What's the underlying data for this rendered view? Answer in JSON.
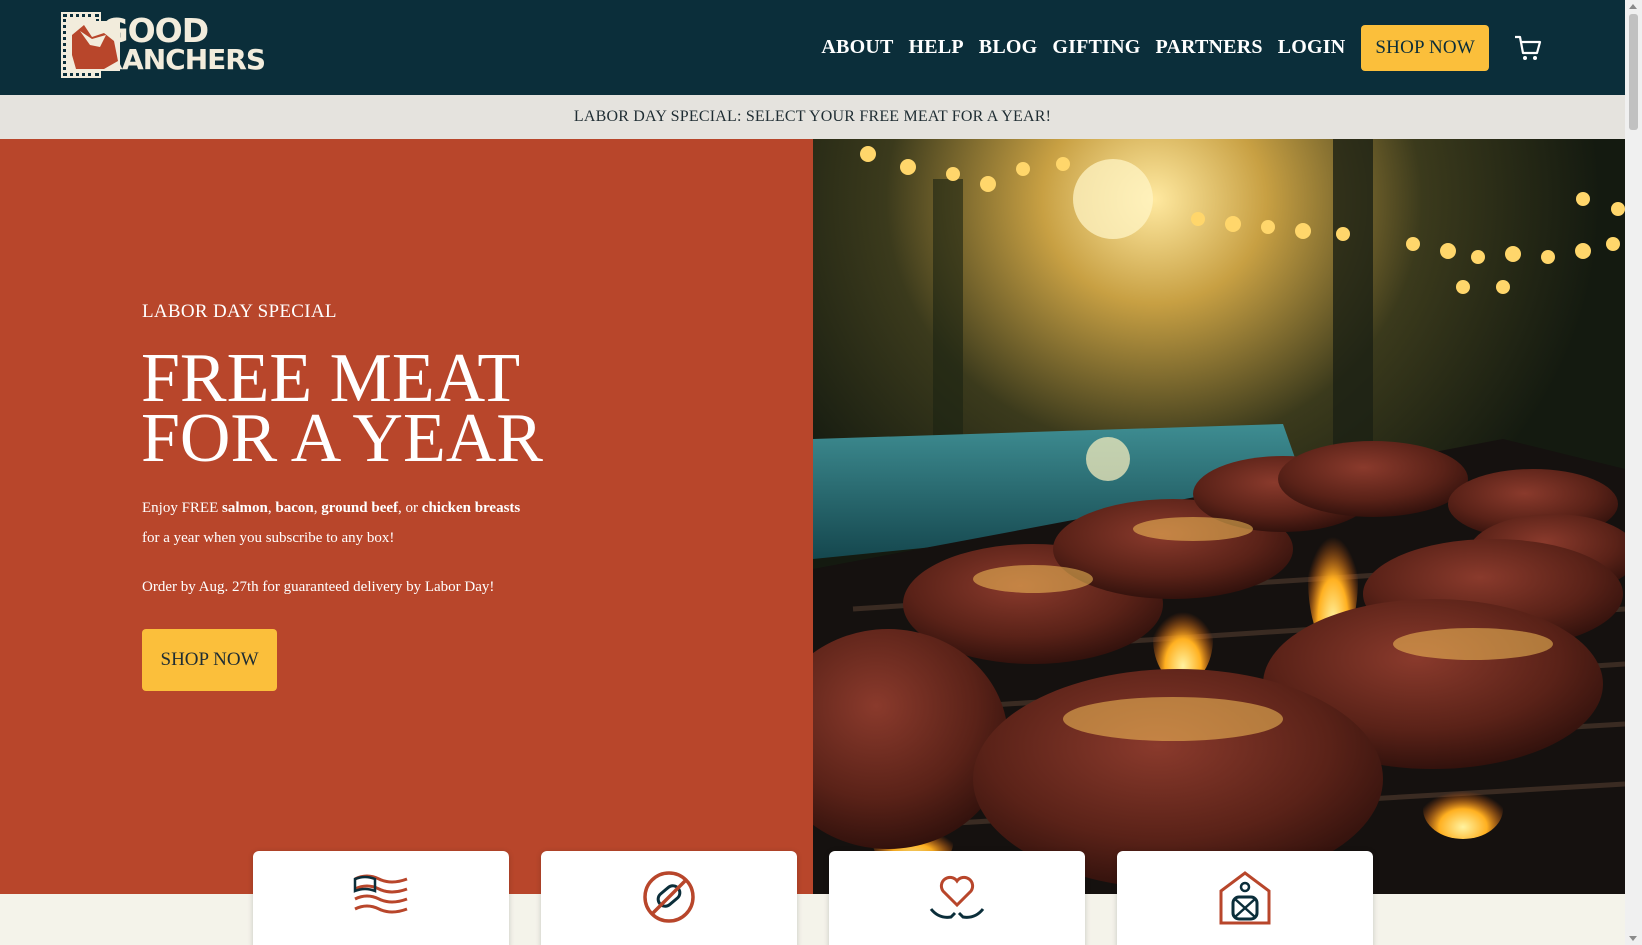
{
  "brand": {
    "line1": "GOOD",
    "line2": "RANCHERS"
  },
  "nav": {
    "items": [
      "ABOUT",
      "HELP",
      "BLOG",
      "GIFTING",
      "PARTNERS",
      "LOGIN"
    ],
    "cta": "SHOP NOW",
    "cart_icon": "cart-icon"
  },
  "promo_bar": {
    "text": "LABOR DAY SPECIAL: SELECT YOUR FREE MEAT FOR A YEAR!"
  },
  "hero": {
    "eyebrow": "LABOR DAY SPECIAL",
    "title_line1": "FREE MEAT",
    "title_line2": "FOR A YEAR",
    "copy": {
      "t1": "Enjoy FREE ",
      "b1": "salmon",
      "t2": ", ",
      "b2": "bacon",
      "t3": ", ",
      "b3": "ground beef",
      "t4": ", or ",
      "b4": "chicken breasts",
      "t5": " for a year when you subscribe to any box!"
    },
    "note": "Order by Aug. 27th for guaranteed delivery by Labor Day!",
    "button": "SHOP NOW",
    "image_alt": "steaks-on-grill-photo"
  },
  "feature_cards": [
    {
      "icon": "american-flag-icon"
    },
    {
      "icon": "no-antibiotics-icon"
    },
    {
      "icon": "heart-hands-icon"
    },
    {
      "icon": "farmer-barn-icon"
    }
  ],
  "colors": {
    "header_bg": "#0b2e3a",
    "hero_bg": "#b8462b",
    "accent": "#fbbf3b",
    "promo_bg": "#e5e3de"
  }
}
